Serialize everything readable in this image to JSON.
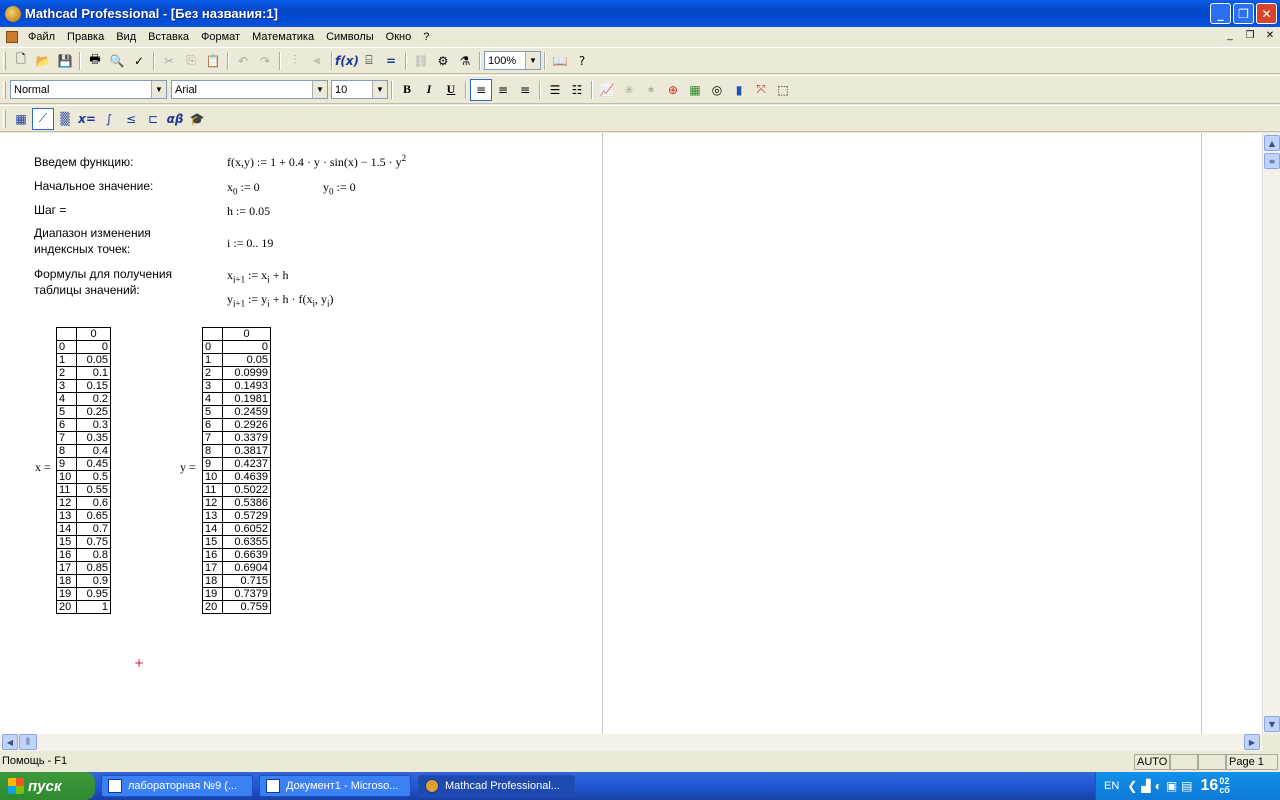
{
  "window": {
    "title": "Mathcad Professional - [Без названия:1]"
  },
  "menu": {
    "items": [
      "Файл",
      "Правка",
      "Вид",
      "Вставка",
      "Формат",
      "Математика",
      "Символы",
      "Окно",
      "?"
    ]
  },
  "toolbar2": {
    "style": "Normal",
    "font": "Arial",
    "size": "10",
    "zoom": "100%"
  },
  "doc": {
    "lbl_func": "Введем функцию:",
    "lbl_init": "Начальное значение:",
    "lbl_step": "Шаг =",
    "lbl_range": "Диапазон изменения индексных точек:",
    "lbl_formulas": "Формулы для получения таблицы значений:",
    "f_def": "f(x,y) := 1 + 0.4 · y · sin(x) − 1.5 · y",
    "f_exp": "2",
    "x0_var": "x",
    "x0_sub": "0",
    "x0_rest": " := 0",
    "y0_var": "y",
    "y0_sub": "0",
    "y0_rest": " := 0",
    "h_def": "h := 0.05",
    "i_def": "i := 0.. 19",
    "xf_a": "x",
    "xf_a_sub": "i+1",
    "xf_b": " := x",
    "xf_b_sub": "i",
    "xf_c": " + h",
    "yf_a": "y",
    "yf_a_sub": "i+1",
    "yf_b": " := y",
    "yf_b_sub": "i",
    "yf_c": " + h · f(x",
    "yf_c_sub": "i",
    "yf_d": ", y",
    "yf_d_sub": "i",
    "yf_e": ")",
    "x_label": "x =",
    "y_label": "y =",
    "col_header": "0",
    "x_values": [
      "0",
      "0.05",
      "0.1",
      "0.15",
      "0.2",
      "0.25",
      "0.3",
      "0.35",
      "0.4",
      "0.45",
      "0.5",
      "0.55",
      "0.6",
      "0.65",
      "0.7",
      "0.75",
      "0.8",
      "0.85",
      "0.9",
      "0.95",
      "1"
    ],
    "y_values": [
      "0",
      "0.05",
      "0.0999",
      "0.1493",
      "0.1981",
      "0.2459",
      "0.2926",
      "0.3379",
      "0.3817",
      "0.4237",
      "0.4639",
      "0.5022",
      "0.5386",
      "0.5729",
      "0.6052",
      "0.6355",
      "0.6639",
      "0.6904",
      "0.715",
      "0.7379",
      "0.759"
    ]
  },
  "status": {
    "help": "Помощь - F1",
    "mode": "AUTO",
    "page": "Page 1"
  },
  "taskbar": {
    "start": "пуск",
    "tasks": [
      "лабораторная №9 (...",
      "Документ1 - Microso...",
      "Mathcad Professional..."
    ],
    "lang": "EN",
    "time_h": "16",
    "time_m": "02",
    "time_s": "сб"
  }
}
